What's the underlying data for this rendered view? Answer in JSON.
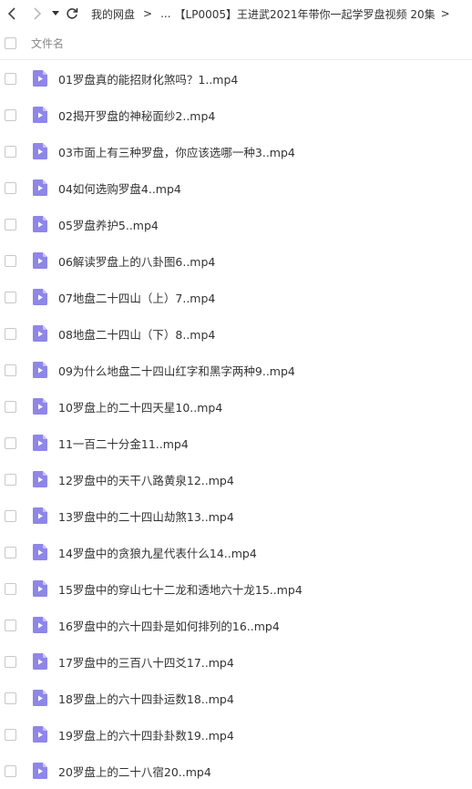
{
  "toolbar": {
    "back_icon": "chevron-left-icon",
    "forward_icon": "chevron-right-icon",
    "dropdown_icon": "caret-down-icon",
    "refresh_icon": "refresh-icon",
    "breadcrumb": {
      "root": "我的网盘",
      "separator": ">",
      "ellipsis": "...",
      "current": "【LP0005】王进武2021年带你一起学罗盘视频 20集",
      "trailing": ">"
    }
  },
  "header": {
    "name_column": "文件名"
  },
  "colors": {
    "video_icon_bg": "#8f86e8",
    "video_icon_fold": "#c7c1f5",
    "video_icon_play": "#ffffff"
  },
  "files": [
    {
      "name": "01罗盘真的能招财化煞吗？1..mp4",
      "icon": "video-file-icon"
    },
    {
      "name": "02揭开罗盘的神秘面纱2..mp4",
      "icon": "video-file-icon"
    },
    {
      "name": "03市面上有三种罗盘，你应该选哪一种3..mp4",
      "icon": "video-file-icon"
    },
    {
      "name": "04如何选购罗盘4..mp4",
      "icon": "video-file-icon"
    },
    {
      "name": "05罗盘养护5..mp4",
      "icon": "video-file-icon"
    },
    {
      "name": "06解读罗盘上的八卦图6..mp4",
      "icon": "video-file-icon"
    },
    {
      "name": "07地盘二十四山（上）7..mp4",
      "icon": "video-file-icon"
    },
    {
      "name": "08地盘二十四山（下）8..mp4",
      "icon": "video-file-icon"
    },
    {
      "name": "09为什么地盘二十四山红字和黑字两种9..mp4",
      "icon": "video-file-icon"
    },
    {
      "name": "10罗盘上的二十四天星10..mp4",
      "icon": "video-file-icon"
    },
    {
      "name": "11一百二十分金11..mp4",
      "icon": "video-file-icon"
    },
    {
      "name": "12罗盘中的天干八路黄泉12..mp4",
      "icon": "video-file-icon"
    },
    {
      "name": "13罗盘中的二十四山劫煞13..mp4",
      "icon": "video-file-icon"
    },
    {
      "name": "14罗盘中的贪狼九星代表什么14..mp4",
      "icon": "video-file-icon"
    },
    {
      "name": "15罗盘中的穿山七十二龙和透地六十龙15..mp4",
      "icon": "video-file-icon"
    },
    {
      "name": "16罗盘中的六十四卦是如何排列的16..mp4",
      "icon": "video-file-icon"
    },
    {
      "name": "17罗盘中的三百八十四爻17..mp4",
      "icon": "video-file-icon"
    },
    {
      "name": "18罗盘上的六十四卦运数18..mp4",
      "icon": "video-file-icon"
    },
    {
      "name": "19罗盘上的六十四卦卦数19..mp4",
      "icon": "video-file-icon"
    },
    {
      "name": "20罗盘上的二十八宿20..mp4",
      "icon": "video-file-icon"
    }
  ]
}
